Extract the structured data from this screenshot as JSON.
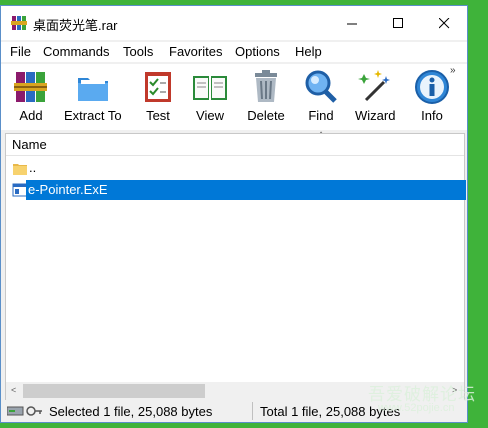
{
  "window": {
    "title": "桌面荧光笔.rar",
    "controls": {
      "minimize": "—",
      "maximize": "☐",
      "close": "✕"
    }
  },
  "menu": [
    "File",
    "Commands",
    "Tools",
    "Favorites",
    "Options",
    "Help"
  ],
  "toolbar": {
    "items": [
      {
        "label": "Add",
        "icon": "add-archive-icon"
      },
      {
        "label": "Extract To",
        "icon": "extract-folder-icon"
      },
      {
        "label": "Test",
        "icon": "test-checklist-icon"
      },
      {
        "label": "View",
        "icon": "view-book-icon"
      },
      {
        "label": "Delete",
        "icon": "trash-icon"
      },
      {
        "label": "Find",
        "icon": "magnifier-icon"
      },
      {
        "label": "Wizard",
        "icon": "magic-wand-icon"
      },
      {
        "label": "Info",
        "icon": "info-icon"
      }
    ],
    "more": "»"
  },
  "filelist": {
    "header": "Name",
    "sort_indicator": "^",
    "rows": [
      {
        "name": "..",
        "icon": "folder-icon",
        "selected": false
      },
      {
        "name": "e-Pointer.ExE",
        "icon": "exe-file-icon",
        "selected": true
      }
    ],
    "scroll_left": "<",
    "scroll_right": ">"
  },
  "status": {
    "left": "Selected 1 file, 25,088 bytes",
    "right": "Total 1 file, 25,088 bytes"
  },
  "watermark": {
    "text": "吾爱破解论坛",
    "url": "www.52pojie.cn"
  },
  "colors": {
    "background": "#3fb33a",
    "selection": "#0078d7",
    "window_border": "#5a8fc9"
  }
}
